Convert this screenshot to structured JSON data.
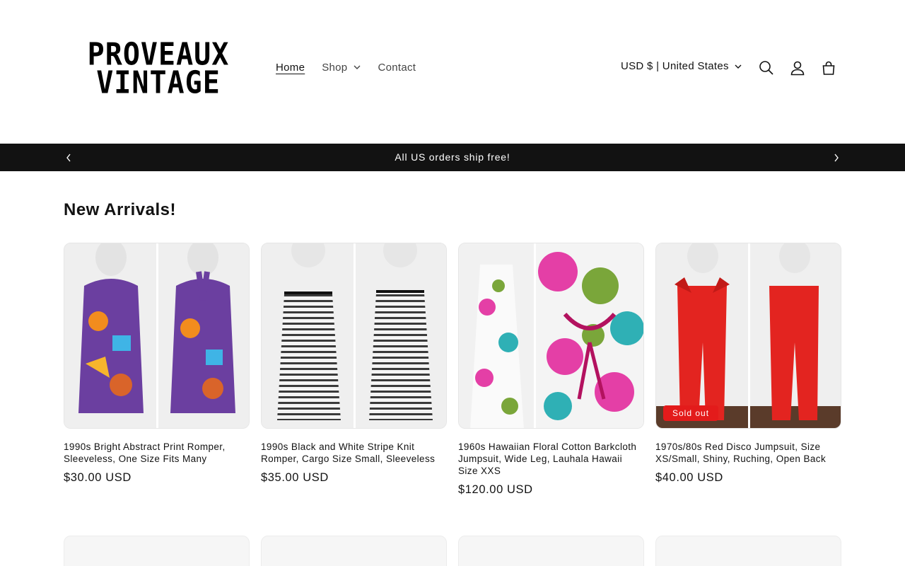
{
  "header": {
    "logo_line1": "PROVEAUX",
    "logo_line2": "VINTAGE",
    "nav": {
      "home": "Home",
      "shop": "Shop",
      "contact": "Contact"
    },
    "currency": "USD $ | United States",
    "icons": [
      "search-icon",
      "account-icon",
      "cart-icon"
    ]
  },
  "announcement": {
    "text": "All US orders ship free!"
  },
  "section": {
    "title": "New Arrivals!"
  },
  "products": [
    {
      "title": "1990s Bright Abstract Print Romper, Sleeveless, One Size Fits Many",
      "price": "$30.00 USD",
      "badge": ""
    },
    {
      "title": "1990s Black and White Stripe Knit Romper, Cargo Size Small, Sleeveless",
      "price": "$35.00 USD",
      "badge": ""
    },
    {
      "title": "1960s Hawaiian Floral Cotton Barkcloth Jumpsuit, Wide Leg, Lauhala Hawaii Size XXS",
      "price": "$120.00 USD",
      "badge": ""
    },
    {
      "title": "1970s/80s Red Disco Jumpsuit, Size XS/Small, Shiny, Ruching, Open Back",
      "price": "$40.00 USD",
      "badge": "Sold out"
    }
  ],
  "colors": {
    "announcement_bg": "#121212",
    "sold_out_badge": "#e31b1b",
    "text": "#121212"
  }
}
